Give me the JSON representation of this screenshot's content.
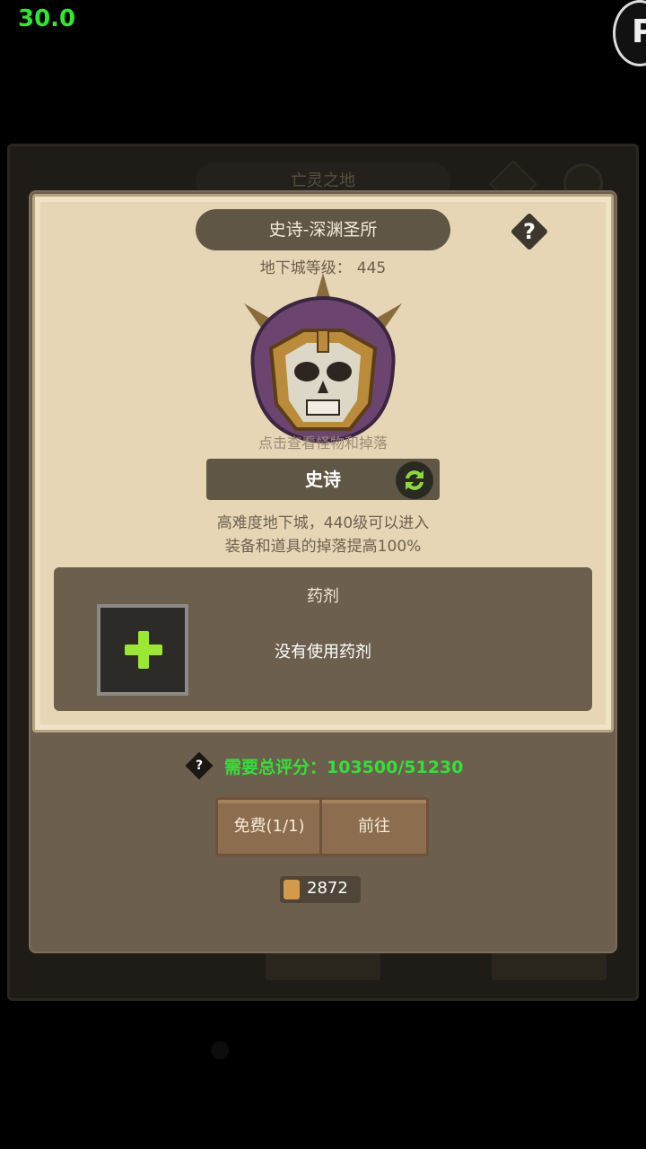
{
  "overlay": {
    "fps": "30.0"
  },
  "background": {
    "title": "亡灵之地"
  },
  "dialog": {
    "title": "史诗-深渊圣所",
    "help_symbol": "?",
    "dungeon_level_label": "地下城等级：",
    "dungeon_level_value": "445",
    "monster_icon": "skull-helmet-icon",
    "tap_hint": "点击查看怪物和掉落",
    "difficulty": "史诗",
    "description_line1": "高难度地下城，440级可以进入",
    "description_line2": "装备和道具的掉落提高100%",
    "potion": {
      "title": "药剂",
      "empty_text": "没有使用药剂"
    },
    "score": {
      "help_symbol": "?",
      "label": "需要总评分：103500/51230"
    },
    "buttons": {
      "free": "免费(1/1)",
      "go": "前往"
    },
    "scroll_count": "2872"
  },
  "colors": {
    "accent_green": "#33e03a",
    "plus_green": "#9be832",
    "parchment": "#e6d6b6",
    "panel_brown": "#6c5f4e"
  }
}
